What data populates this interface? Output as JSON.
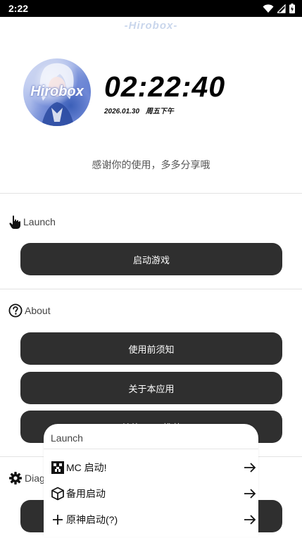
{
  "status_bar": {
    "time": "2:22"
  },
  "header": {
    "logo_text": "-Hirobox-"
  },
  "avatar": {
    "text": "Hirobox"
  },
  "clock": {
    "time": "02:22:40",
    "date": "2026.01.30",
    "weekday": "周五下午"
  },
  "thanks_text": "感谢你的使用，多多分享哦",
  "sections": {
    "launch": {
      "title": "Launch",
      "button": "启动游戏"
    },
    "about": {
      "title": "About",
      "buttons": [
        "使用前须知",
        "关于本应用",
        "其他 ⋯⋯ 推荐"
      ]
    },
    "diag": {
      "title": "Diag"
    }
  },
  "popup": {
    "title": "Launch",
    "items": [
      {
        "label": "MC 启动!",
        "icon": "creeper-face-icon"
      },
      {
        "label": "备用启动",
        "icon": "cube-icon"
      },
      {
        "label": "原神启动(?)",
        "icon": "plus-icon"
      }
    ]
  },
  "colors": {
    "button_bg": "#2f2f2f",
    "background": "#ffffff",
    "logo": "#c9d6ec"
  }
}
